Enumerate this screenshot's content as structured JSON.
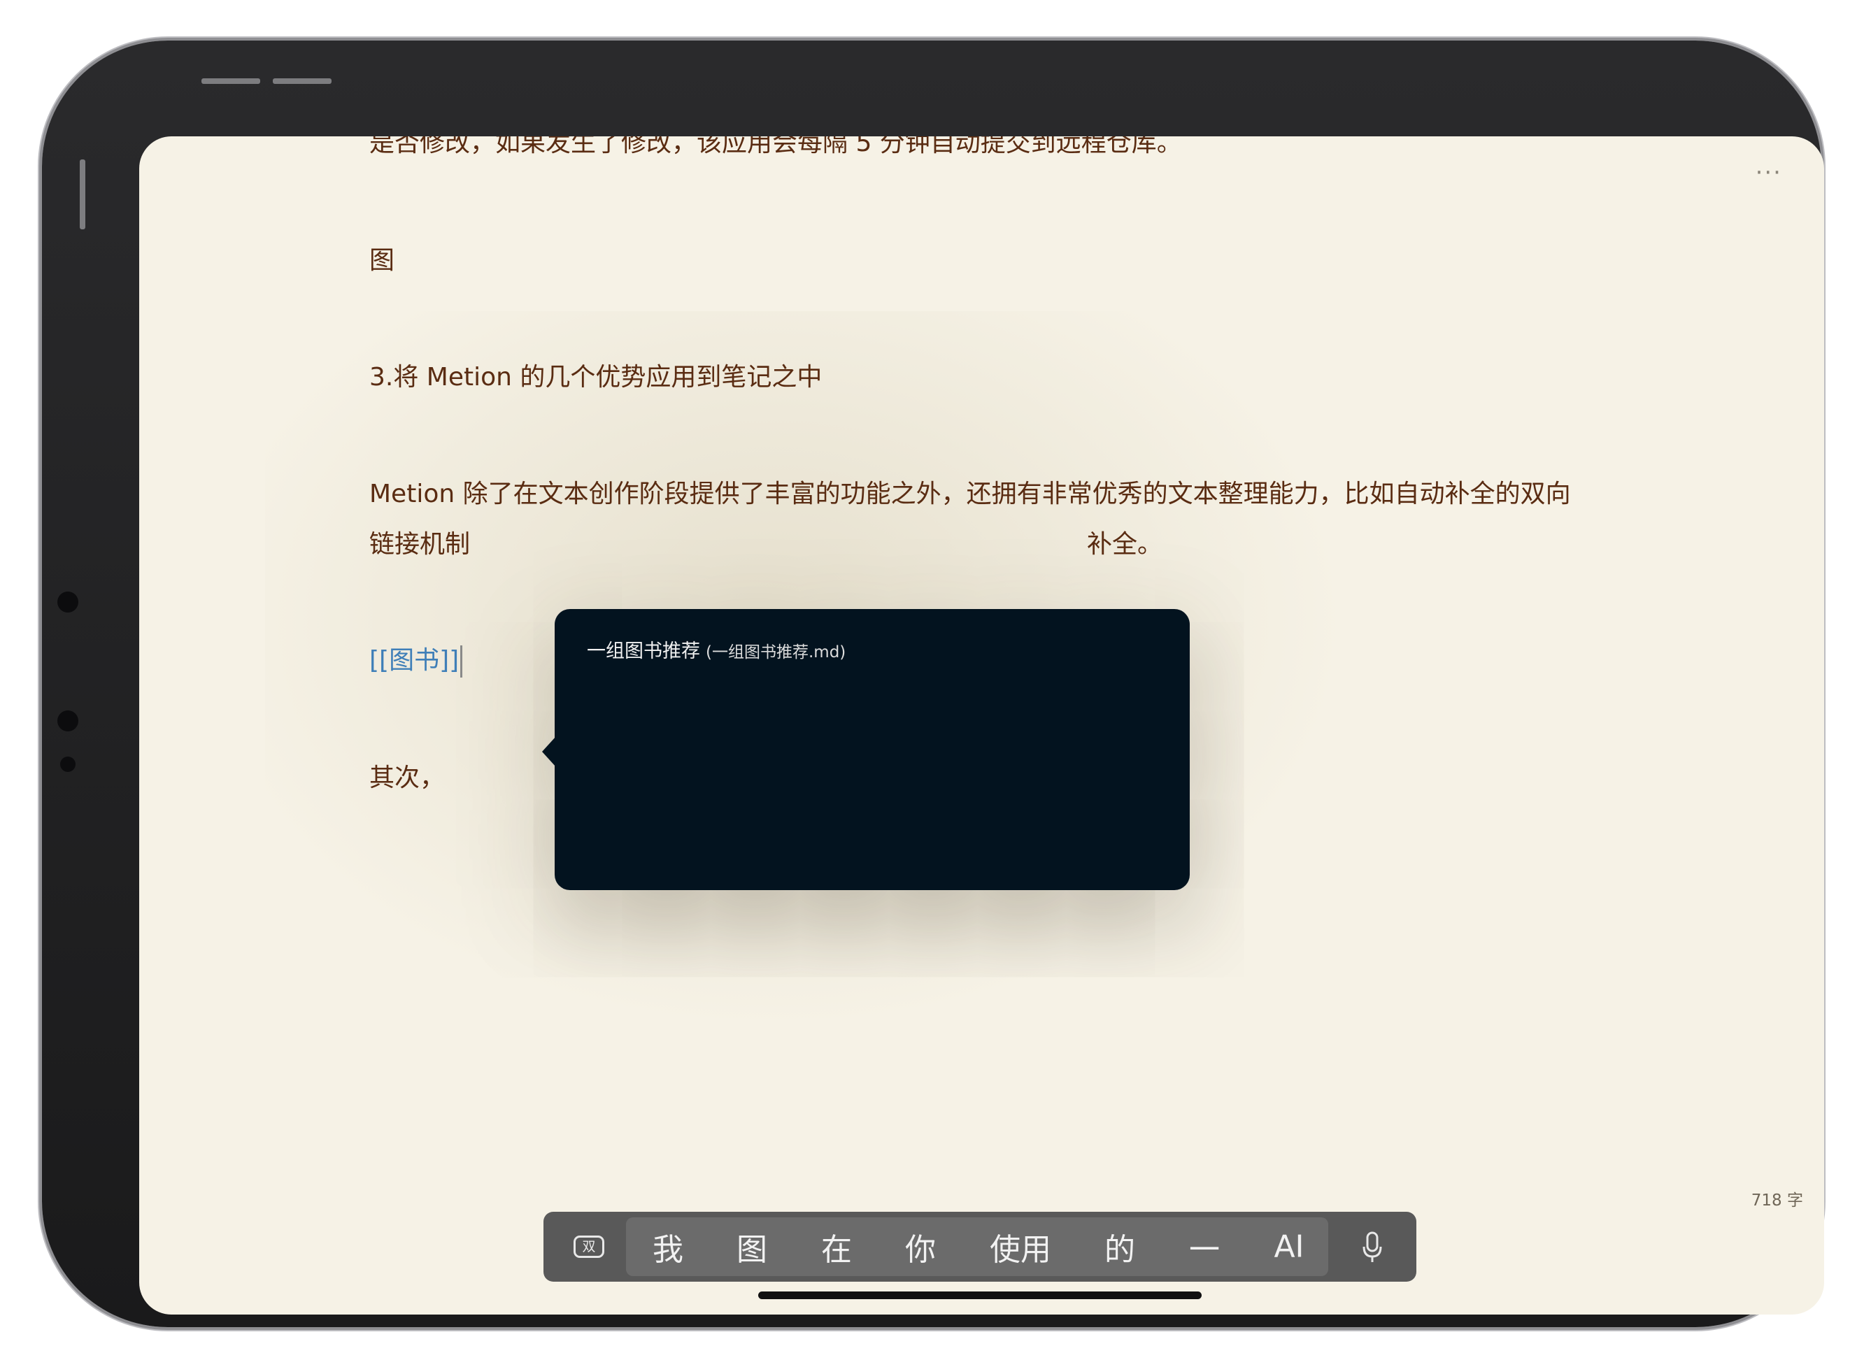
{
  "document": {
    "lines": [
      "是否修改，如果发生了修改，该应用会每隔 5 分钟自动提交到远程仓库。",
      "图",
      "3.将 Metion 的几个优势应用到笔记之中",
      "Metion 除了在文本创作阶段提供了丰富的功能之外，还拥有非常优秀的文本整理能力，比如自动补全的双向",
      "链接机制",
      "补全。",
      "[[图书]]",
      "其次，"
    ]
  },
  "toolbar": {
    "more_label": "···"
  },
  "autocomplete": {
    "suggestion_title": "一组图书推荐",
    "suggestion_file": "(一组图书推荐.md)"
  },
  "status": {
    "word_count": "718 字"
  },
  "ime": {
    "toggle_label": "双",
    "candidates": [
      "我",
      "图",
      "在",
      "你",
      "使用",
      "的",
      "一",
      "AI"
    ]
  },
  "icons": {
    "mic": "microphone-icon",
    "toggle": "keyboard-toggle-icon",
    "more": "more-icon"
  }
}
